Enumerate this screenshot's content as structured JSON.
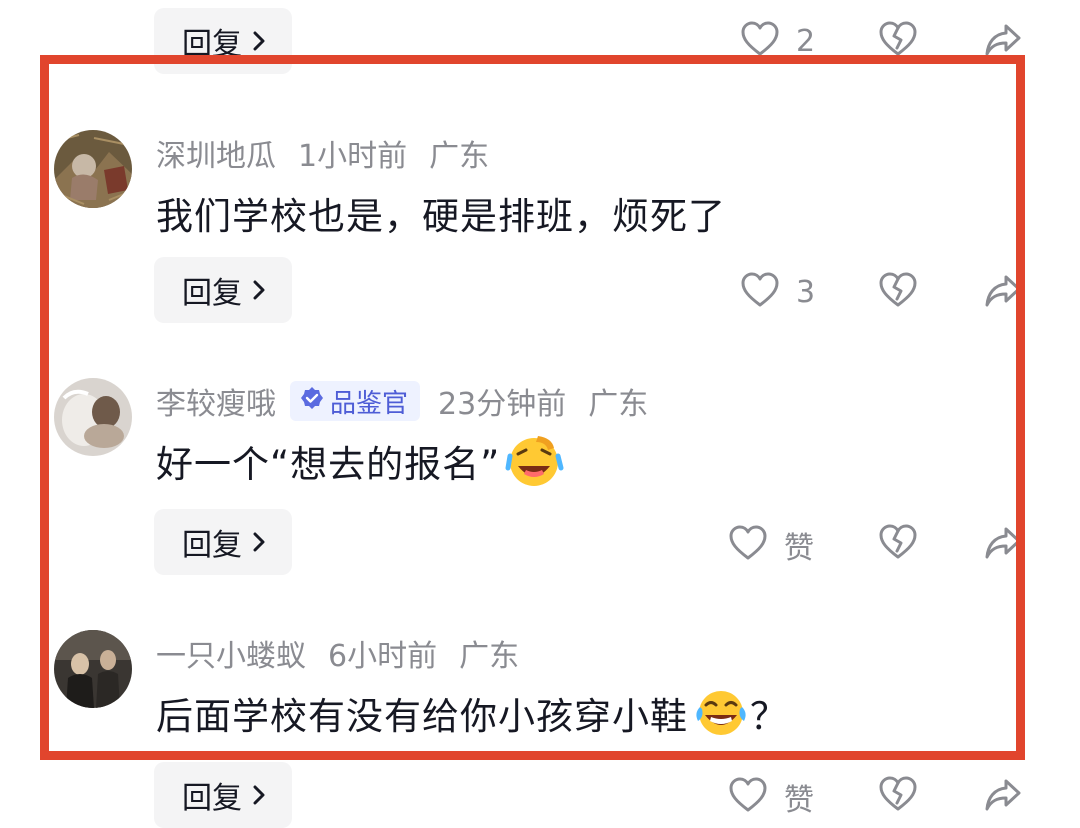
{
  "top_partial": {
    "reply_label": "回复",
    "like_count": "2"
  },
  "comments": [
    {
      "username": "深圳地瓜",
      "time": "1小时前",
      "location": "广东",
      "text": "我们学校也是，硬是排班，烦死了",
      "reply_label": "回复",
      "like_count": "3"
    },
    {
      "username": "李较瘦哦",
      "badge": "品鉴官",
      "time": "23分钟前",
      "location": "广东",
      "text": "好一个“想去的报名”",
      "reply_label": "回复",
      "like_count": "赞"
    },
    {
      "username": "一只小蝼蚁",
      "time": "6小时前",
      "location": "广东",
      "text": "后面学校有没有给你小孩穿小鞋",
      "text_suffix": "？",
      "reply_label": "回复",
      "like_count": "赞"
    }
  ],
  "colors": {
    "highlight_border": "#e1452d",
    "meta_text": "#8a8b91",
    "body_text": "#161823",
    "button_bg": "#f4f4f5",
    "badge_bg": "#eef2ff",
    "badge_text": "#4e5dd6"
  },
  "icons": [
    "heart-icon",
    "broken-heart-icon",
    "share-icon",
    "chevron-right-icon",
    "verified-badge-icon",
    "laughing-emoji",
    "tears-of-joy-emoji"
  ]
}
